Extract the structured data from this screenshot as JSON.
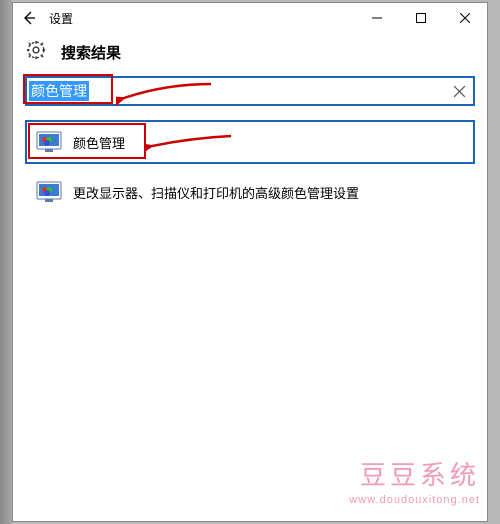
{
  "titlebar": {
    "title": "设置"
  },
  "header": {
    "title": "搜索结果"
  },
  "search": {
    "value": "颜色管理"
  },
  "results": [
    {
      "label": "颜色管理",
      "selected": true
    },
    {
      "label": "更改显示器、扫描仪和打印机的高级颜色管理设置",
      "selected": false
    }
  ],
  "watermark": {
    "main": "豆豆系统",
    "url": "www.doudouxitong.net"
  }
}
